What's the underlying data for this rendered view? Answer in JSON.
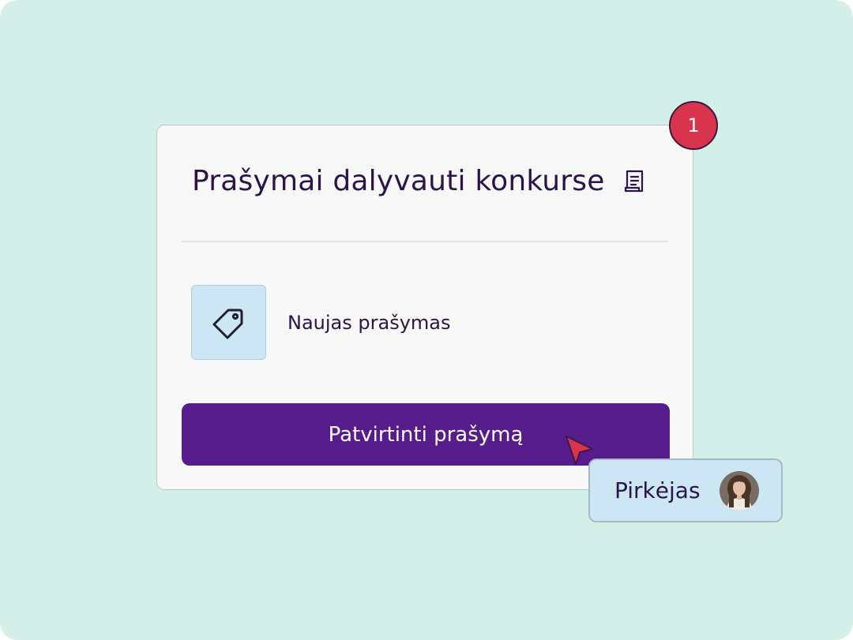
{
  "card": {
    "title": "Prašymai dalyvauti konkurse",
    "title_icon": "document-icon",
    "item": {
      "label": "Naujas prašymas",
      "icon": "tag-icon"
    },
    "confirm_button_label": "Patvirtinti prašymą"
  },
  "notification_badge": {
    "count": "1"
  },
  "user_tag": {
    "name": "Pirkėjas",
    "avatar_icon": "avatar"
  },
  "cursor_icon": "cursor-pointer-icon",
  "colors": {
    "background": "#d4eee8",
    "card": "#f8f8f9",
    "primary": "#571c8c",
    "badge": "#d8344e",
    "tag_tint": "#cce6f4",
    "text": "#2a1449"
  }
}
